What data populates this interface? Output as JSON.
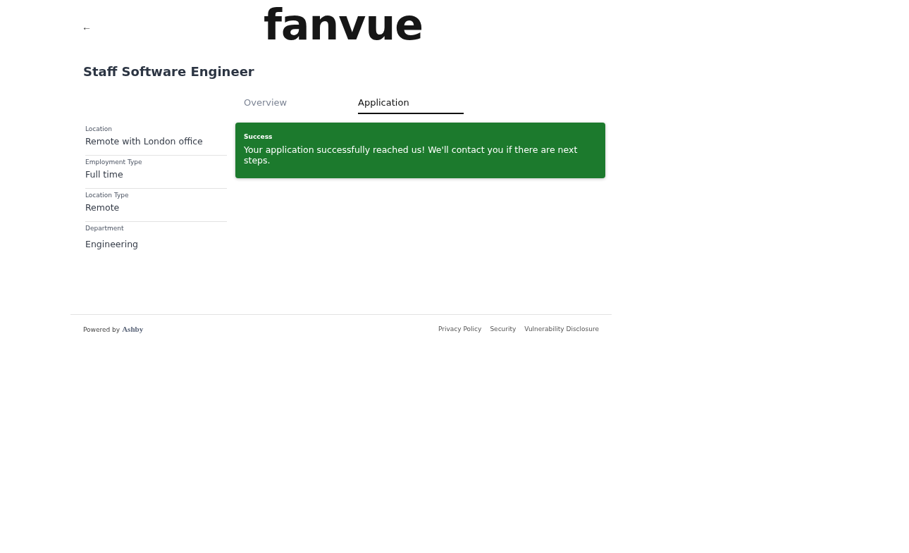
{
  "header": {
    "back": "←",
    "logo": "fanvue"
  },
  "job_title": "Staff Software Engineer",
  "tabs": [
    {
      "label": "Overview",
      "selected": false
    },
    {
      "label": "Application",
      "selected": true
    }
  ],
  "details": [
    {
      "label": "Location",
      "value": "Remote with London office"
    },
    {
      "label": "Employment Type",
      "value": "Full time"
    },
    {
      "label": "Location Type",
      "value": "Remote"
    },
    {
      "label": "Department",
      "value": "Engineering"
    }
  ],
  "alert": {
    "kind": "success",
    "title": "Success",
    "message": "Your application successfully reached us! We'll contact you if there are next steps."
  },
  "footer": {
    "powered_by": "Powered by",
    "brand": "Ashby",
    "links": [
      "Privacy Policy",
      "Security",
      "Vulnerability Disclosure"
    ]
  }
}
